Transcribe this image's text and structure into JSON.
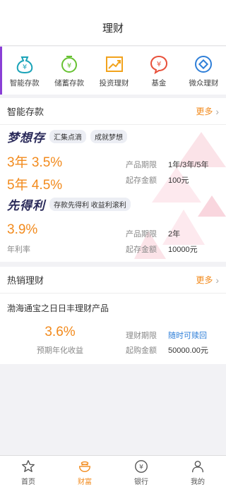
{
  "header": {
    "title": "理财"
  },
  "categories": [
    {
      "label": "智能存款",
      "icon": "money-bag-icon"
    },
    {
      "label": "储蓄存款",
      "icon": "piggy-clock-icon"
    },
    {
      "label": "投资理财",
      "icon": "trend-chart-icon"
    },
    {
      "label": "基金",
      "icon": "yuan-badge-icon"
    },
    {
      "label": "微众理财",
      "icon": "webank-icon"
    }
  ],
  "smart_deposit": {
    "title": "智能存款",
    "more": "更多",
    "product1": {
      "name": "梦想存",
      "tags": [
        "汇集点滴",
        "成就梦想"
      ],
      "rates": [
        "3年 3.5%",
        "5年 4.5%"
      ],
      "term_label": "产品期限",
      "term_value": "1年/3年/5年",
      "min_label": "起存金额",
      "min_value": "100元"
    },
    "product2": {
      "name": "先得利",
      "tag": "存款先得利 收益利滚利",
      "rate": "3.9%",
      "rate_caption": "年利率",
      "term_label": "产品期限",
      "term_value": "2年",
      "min_label": "起存金额",
      "min_value": "10000元"
    }
  },
  "hot": {
    "title": "热销理财",
    "more": "更多",
    "product_name": "渤海通宝之日日丰理财产品",
    "rate": "3.6%",
    "rate_caption": "预期年化收益",
    "term_label": "理财期限",
    "term_value": "随时可赎回",
    "min_label": "起购金额",
    "min_value": "50000.00元"
  },
  "tabs": [
    {
      "label": "首页",
      "icon": "star-icon",
      "active": false
    },
    {
      "label": "财富",
      "icon": "coin-cup-icon",
      "active": true
    },
    {
      "label": "银行",
      "icon": "yuan-circle-icon",
      "active": false
    },
    {
      "label": "我的",
      "icon": "person-icon",
      "active": false
    }
  ],
  "colors": {
    "accent": "#f28a1c",
    "header_left_bar": "#8a3fd6",
    "link_blue": "#2f7fd8"
  }
}
